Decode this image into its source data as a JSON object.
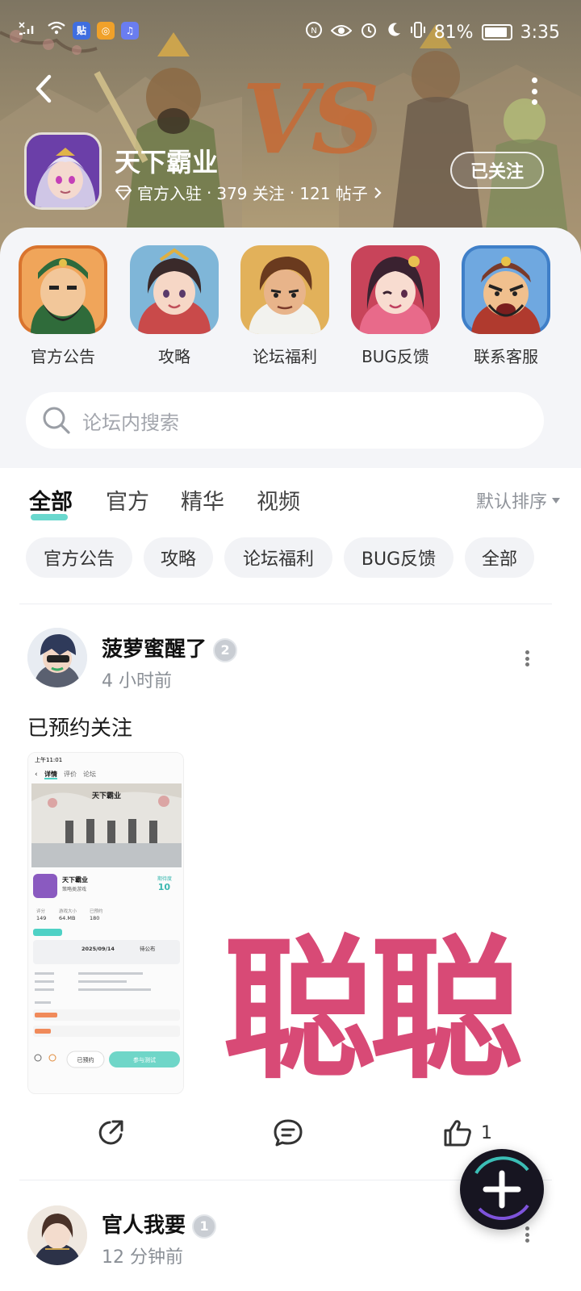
{
  "status_bar": {
    "time": "3:35",
    "battery": "81%",
    "left_app_icons": [
      "tieba-icon",
      "game-app-icon",
      "music-app-icon"
    ]
  },
  "header": {
    "forum_title": "天下霸业",
    "official_label": "官方入驻",
    "followers": "379 关注",
    "posts": "121 帖子",
    "separator": "·",
    "follow_button": "已关注",
    "vs_graphic": "VS"
  },
  "quick_links": [
    {
      "label": "官方公告",
      "icon": "general-portrait-icon"
    },
    {
      "label": "攻略",
      "icon": "princess-portrait-icon"
    },
    {
      "label": "论坛福利",
      "icon": "warrior-portrait-icon"
    },
    {
      "label": "BUG反馈",
      "icon": "girl-portrait-icon"
    },
    {
      "label": "联系客服",
      "icon": "angry-general-portrait-icon"
    }
  ],
  "search": {
    "placeholder": "论坛内搜索"
  },
  "tabs": [
    {
      "label": "全部",
      "active": true
    },
    {
      "label": "官方",
      "active": false
    },
    {
      "label": "精华",
      "active": false
    },
    {
      "label": "视频",
      "active": false
    }
  ],
  "sort_label": "默认排序",
  "chips": [
    "官方公告",
    "攻略",
    "论坛福利",
    "BUG反馈",
    "全部"
  ],
  "post": {
    "author": "菠萝蜜醒了",
    "level": "2",
    "time": "4 小时前",
    "text": "已预约关注",
    "overlay_text": "聪聪",
    "like_count": "1",
    "screenshot": {
      "status_time": "上午11:01",
      "tabs": [
        "详情",
        "评价",
        "论坛"
      ],
      "game_title": "天下霸业",
      "game_subtitle": "策略类游戏",
      "score_label": "期待度",
      "score": "10",
      "stats": [
        "评分",
        "游戏大小",
        "已预约"
      ],
      "stat_values": [
        "149",
        "64.MB",
        "180"
      ],
      "date": "2025/09/14",
      "date_right": "待公布",
      "buttons": [
        "已预约",
        "参与测试"
      ]
    }
  },
  "post2": {
    "author": "官人我要",
    "level": "1",
    "time": "12 分钟前"
  },
  "colors": {
    "accent": "#4fd1c5",
    "watermark": "#d84a76",
    "fab": "#171521"
  }
}
